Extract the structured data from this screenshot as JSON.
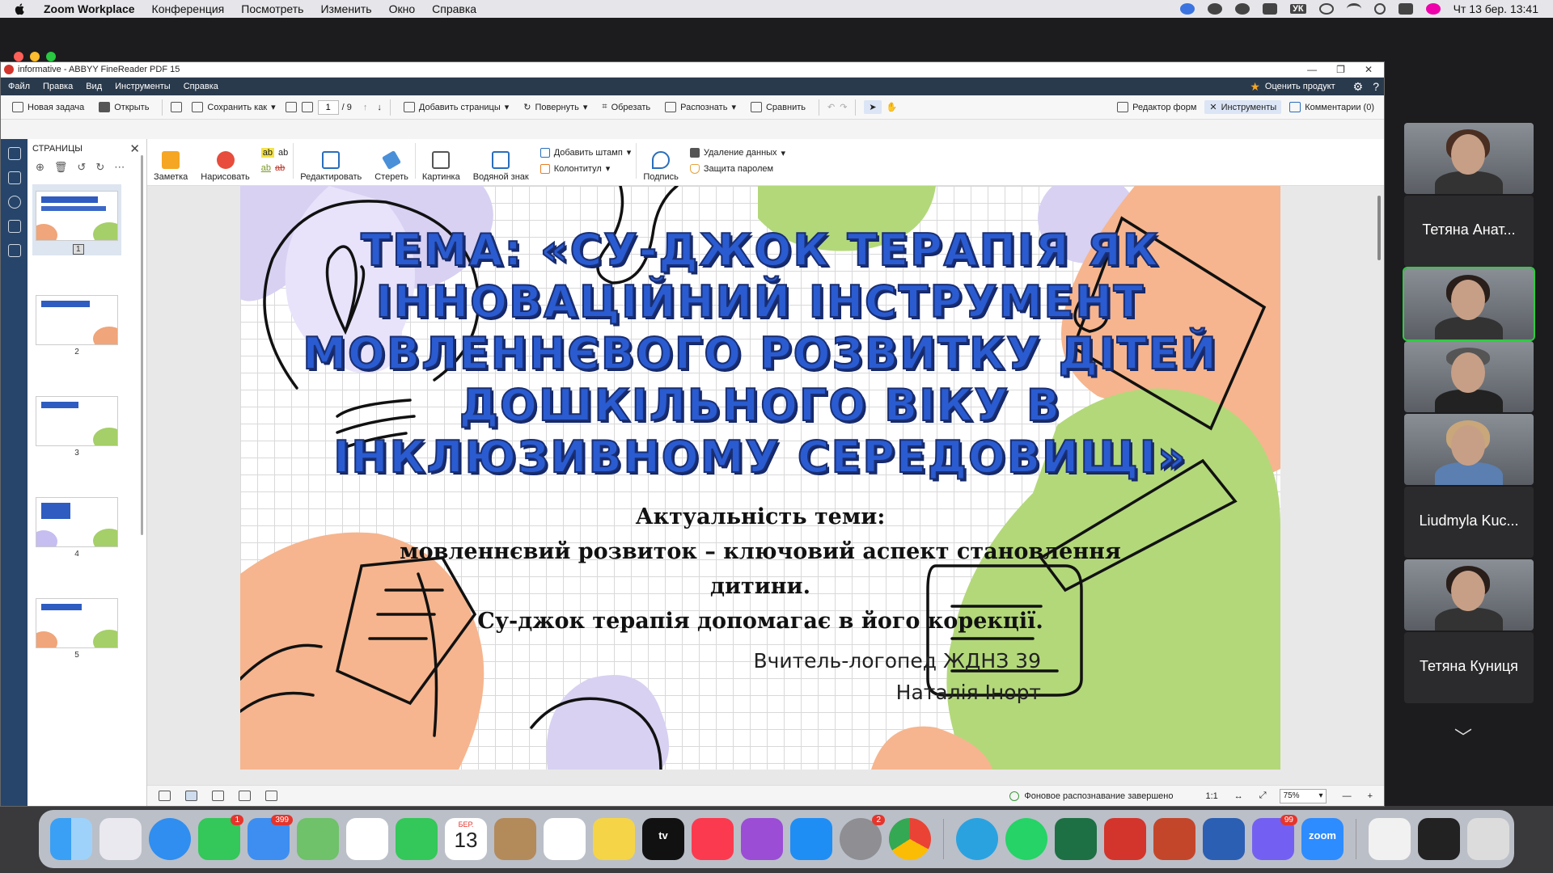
{
  "mac_menu": {
    "app_name": "Zoom Workplace",
    "items": [
      "Конференция",
      "Посмотреть",
      "Изменить",
      "Окно",
      "Справка"
    ],
    "tray_text": "УК",
    "datetime": "Чт 13 бер.  13:41"
  },
  "abbyy": {
    "window_title": "informative - ABBYY FineReader PDF 15",
    "menu": [
      "Файл",
      "Правка",
      "Вид",
      "Инструменты",
      "Справка"
    ],
    "rate_label": "Оценить продукт",
    "toolbar": {
      "new_task": "Новая задача",
      "open": "Открыть",
      "save_as": "Сохранить как",
      "page_current": "1",
      "page_total": "/ 9",
      "add_pages": "Добавить страницы",
      "rotate": "Повернуть",
      "crop": "Обрезать",
      "recognize": "Распознать",
      "compare": "Сравнить",
      "form_editor": "Редактор форм",
      "tools": "Инструменты",
      "comments": "Комментарии (0)"
    },
    "pages_panel": {
      "title": "СТРАНИЦЫ",
      "thumbnails": [
        "1",
        "2",
        "3",
        "4",
        "5"
      ]
    },
    "ribbon": {
      "note": "Заметка",
      "draw": "Нарисовать",
      "edit": "Редактировать",
      "erase": "Стереть",
      "picture": "Картинка",
      "watermark": "Водяной знак",
      "add_stamp": "Добавить штамп",
      "header_footer": "Колонтитул",
      "sign": "Подпись",
      "redact": "Удаление данных",
      "password": "Защита паролем"
    },
    "slide": {
      "title": "ТЕМА: «СУ-ДЖОК ТЕРАПІЯ ЯК ІННОВАЦІЙНИЙ ІНСТРУМЕНТ МОВЛЕННЄВОГО РОЗВИТКУ ДІТЕЙ ДОШКІЛЬНОГО ВІКУ В ІНКЛЮЗИВНОМУ СЕРЕДОВИЩІ»",
      "sub1": "Актуальність теми:",
      "sub2": "мовленнєвий розвиток – ключовий аспект становлення дитини.",
      "sub3": "Су-джок терапія допомагає в його корекції.",
      "author1": "Вчитель-логопед ЖДНЗ 39",
      "author2": "Наталія Інорт"
    },
    "status": {
      "recognition": "Фоновое распознавание завершено",
      "ratio": "1:1",
      "zoom": "75%"
    }
  },
  "participants": [
    {
      "name": "Тетяна Анат...",
      "video": true
    },
    {
      "name": "",
      "video": true,
      "highlight": true
    },
    {
      "name": "",
      "video": true
    },
    {
      "name": "Liudmyla Kuc...",
      "video": true
    },
    {
      "name": "Тетяна Куниця",
      "video": true
    }
  ],
  "dock": {
    "badges": {
      "messages": "1",
      "mail": "399",
      "settings": "2",
      "viber": "99"
    },
    "calendar_month": "БЕР.",
    "calendar_day": "13",
    "tv_label": "tv",
    "zoom_label": "zoom"
  },
  "colors": {
    "abbyy_menu_bg": "#2a3a4d",
    "slide_title": "#2a5bd0",
    "blob_orange": "#f6b58e",
    "blob_green": "#b3d87a",
    "blob_lavender": "#d8d1f2",
    "active_speaker": "#2ecc40"
  }
}
